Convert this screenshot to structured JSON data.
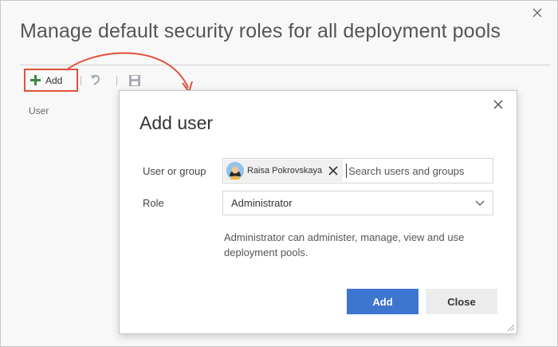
{
  "outer_dialog": {
    "title": "Manage default security roles for all deployment pools",
    "toolbar": {
      "add_label": "Add",
      "undo_icon": "undo-icon",
      "save_icon": "save-icon"
    },
    "column_header": "User"
  },
  "add_user_dialog": {
    "title": "Add user",
    "user_label": "User or group",
    "selected_user": {
      "name": "Raisa Pokrovskaya",
      "avatar": "person-avatar"
    },
    "search_placeholder": "Search users and groups",
    "role_label": "Role",
    "role_value": "Administrator",
    "description": "Administrator can administer, manage, view and use deployment pools.",
    "add_button": "Add",
    "close_button": "Close"
  },
  "colors": {
    "primary": "#3e75d0",
    "highlight": "#e0533b",
    "add_icon": "#3a8a3a"
  }
}
